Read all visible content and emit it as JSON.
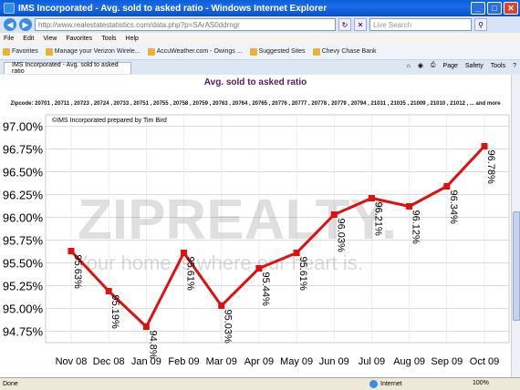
{
  "window": {
    "title": "IMS Incorporated - Avg. sold to asked ratio - Windows Internet Explorer",
    "minimize": "_",
    "maximize": "□",
    "close": "✕"
  },
  "address": {
    "url": "http://www.realestatestatistics.com/data.php?p=SArAS0ddrngr",
    "search_placeholder": "Live Search"
  },
  "menu": [
    "File",
    "Edit",
    "View",
    "Favorites",
    "Tools",
    "Help"
  ],
  "favorites": {
    "label": "Favorites",
    "items": [
      "Manage your Verizon Wirele...",
      "AccuWeather.com - Owings ...",
      "Suggested Sites",
      "Chevy Chase Bank"
    ]
  },
  "tab": {
    "label": "IMS Incorporated - Avg. sold to asked ratio",
    "tools": [
      "Page",
      "Safety",
      "Tools"
    ]
  },
  "page": {
    "heading": "Avg. sold to asked ratio",
    "zipcodes": "Zipcode: 20701 , 20711 , 20723 , 20724 , 20733 , 20751 , 20755 , 20758 , 20759 , 20763 , 20764 , 20765 , 20776 , 20777 , 20778 , 20779 , 20794 , 21031 , 21035 , 21009 , 21010 , 21012 , ... and more"
  },
  "chart_data": {
    "type": "line",
    "credit": "©IMS Incorporated prepared by Tim Bird",
    "watermark_brand": "ZIPREALTY.",
    "watermark_tagline": "Your home is where our heart is.",
    "categories": [
      "Nov 08",
      "Dec 08",
      "Jan 09",
      "Feb 09",
      "Mar 09",
      "Apr 09",
      "May 09",
      "Jun 09",
      "Jul 09",
      "Aug 09",
      "Sep 09",
      "Oct 09"
    ],
    "values": [
      95.63,
      95.19,
      94.8,
      95.61,
      95.03,
      95.44,
      95.61,
      96.03,
      96.21,
      96.12,
      96.34,
      96.78
    ],
    "value_labels": [
      "95.63%",
      "95.19%",
      "94.8%",
      "95.61%",
      "95.03%",
      "95.44%",
      "95.61%",
      "96.03%",
      "96.21%",
      "96.12%",
      "96.34%",
      "96.78%"
    ],
    "yticks": [
      "94.75%",
      "95.00%",
      "95.25%",
      "95.50%",
      "95.75%",
      "96.00%",
      "96.25%",
      "96.50%",
      "96.75%",
      "97.00%"
    ],
    "ytick_values": [
      94.75,
      95.0,
      95.25,
      95.5,
      95.75,
      96.0,
      96.25,
      96.5,
      96.75,
      97.0
    ],
    "ylim": [
      94.625,
      97.125
    ],
    "grid": true,
    "line_color": "#e01010"
  },
  "status": {
    "left": "Done",
    "zone": "Internet",
    "zoom": "100%"
  }
}
